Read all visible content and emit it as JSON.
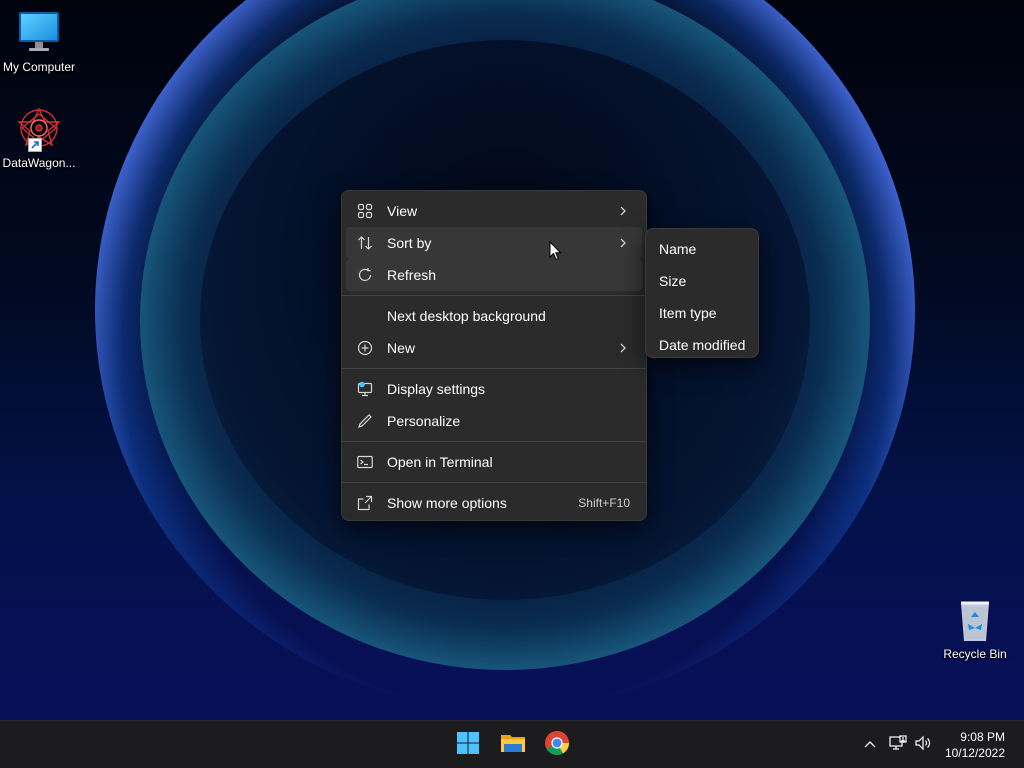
{
  "desktop": {
    "icons": [
      {
        "label": "My Computer",
        "icon": "monitor-icon"
      },
      {
        "label": "DataWagon...",
        "icon": "datawagon-app-icon"
      },
      {
        "label": "Recycle Bin",
        "icon": "recycle-bin-icon"
      }
    ]
  },
  "context_menu": {
    "items": [
      {
        "label": "View",
        "icon": "grid-icon",
        "submenu": true
      },
      {
        "label": "Sort by",
        "icon": "sort-arrows-icon",
        "submenu": true,
        "highlighted": true
      },
      {
        "label": "Refresh",
        "icon": "refresh-icon",
        "highlighted": true
      },
      {
        "label": "Next desktop background"
      },
      {
        "label": "New",
        "icon": "plus-circle-icon",
        "submenu": true
      },
      {
        "label": "Display settings",
        "icon": "display-settings-icon"
      },
      {
        "label": "Personalize",
        "icon": "pen-icon"
      },
      {
        "label": "Open in Terminal",
        "icon": "terminal-icon"
      },
      {
        "label": "Show more options",
        "icon": "share-icon",
        "shortcut": "Shift+F10"
      }
    ]
  },
  "sort_submenu": {
    "items": [
      "Name",
      "Size",
      "Item type",
      "Date modified"
    ]
  },
  "taskbar": {
    "apps": [
      "start-icon",
      "file-explorer-icon",
      "chrome-icon"
    ],
    "tray": [
      "chevron-up-icon",
      "network-icon",
      "volume-icon"
    ],
    "time": "9:08 PM",
    "date": "10/12/2022"
  },
  "colors": {
    "menu_bg": "#2b2b2b",
    "menu_highlight": "#373737",
    "taskbar_bg": "#1c1c1e",
    "accent": "#4cc2ff"
  }
}
